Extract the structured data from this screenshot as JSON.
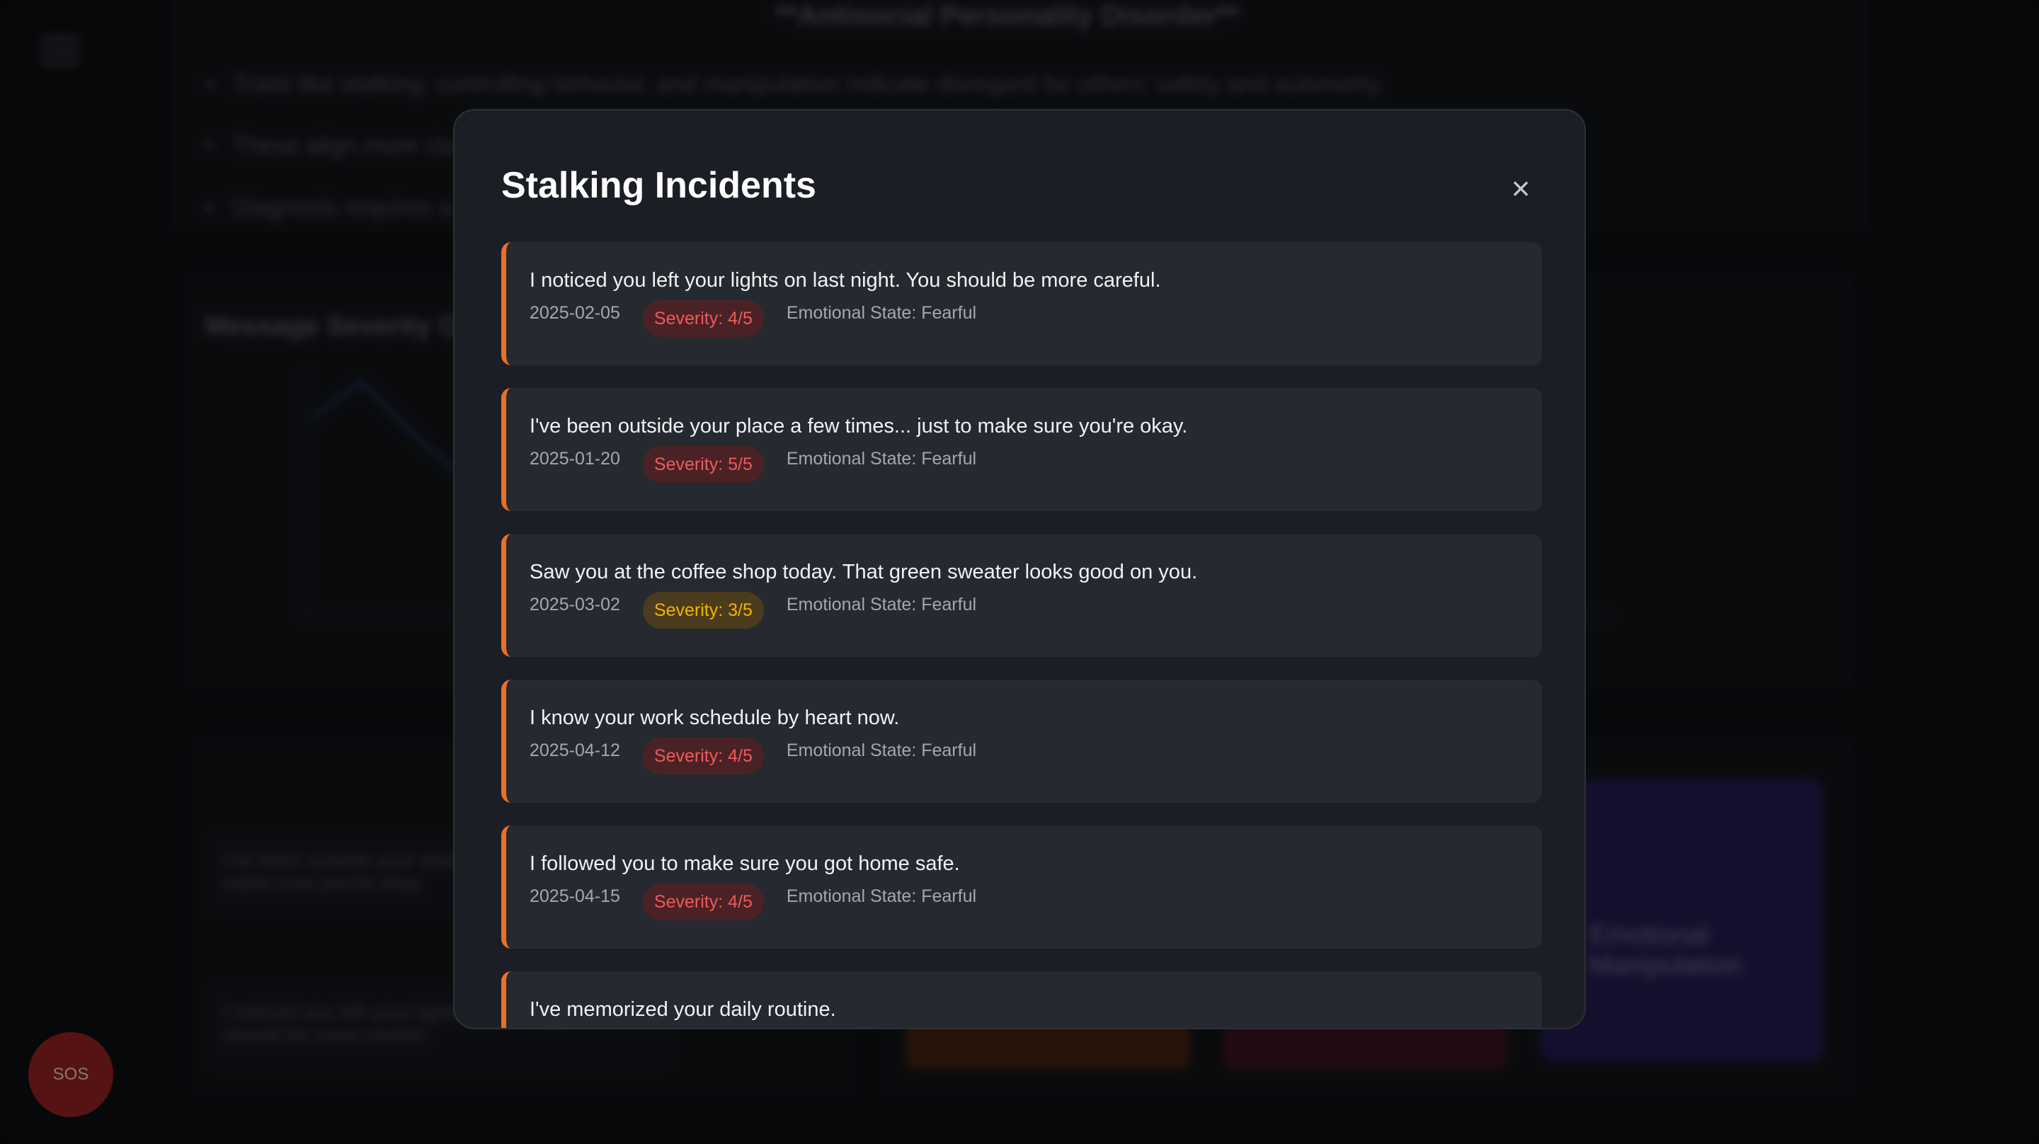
{
  "background": {
    "heading": "**Antisocial Personality Disorder**",
    "bullets": [
      "Traits like stalking, controlling behavior, and manipulation indicate disregard for others' safety and autonomy.",
      "These align more closely with",
      "Diagnosis requires a"
    ],
    "chart_title": "Message Severity Over Time",
    "messages": [
      "I've been outside your place a few times... just to make sure you're okay.",
      "I noticed you left your lights on last night. You should be more careful."
    ],
    "purple_card_text": "Emotional Manipulation",
    "fab_label": "SOS"
  },
  "modal": {
    "title": "Stalking Incidents",
    "close_icon": "×",
    "incidents": [
      {
        "text": "I noticed you left your lights on last night. You should be more careful.",
        "date": "2025-02-05",
        "severity": "Severity: 4/5",
        "emotional_state": "Emotional State: Fearful"
      },
      {
        "text": "I've been outside your place a few times... just to make sure you're okay.",
        "date": "2025-01-20",
        "severity": "Severity: 5/5",
        "emotional_state": "Emotional State: Fearful"
      },
      {
        "text": "Saw you at the coffee shop today. That green sweater looks good on you.",
        "date": "2025-03-02",
        "severity": "Severity: 3/5",
        "emotional_state": "Emotional State: Fearful"
      },
      {
        "text": "I know your work schedule by heart now.",
        "date": "2025-04-12",
        "severity": "Severity: 4/5",
        "emotional_state": "Emotional State: Fearful"
      },
      {
        "text": "I followed you to make sure you got home safe.",
        "date": "2025-04-15",
        "severity": "Severity: 4/5",
        "emotional_state": "Emotional State: Fearful"
      },
      {
        "text": "I've memorized your daily routine.",
        "date": "",
        "severity": "",
        "emotional_state": ""
      }
    ]
  },
  "colors": {
    "accent_orange": "#ea6f27",
    "severity_high": "#ef5a59",
    "severity_medium": "#f0b400"
  }
}
